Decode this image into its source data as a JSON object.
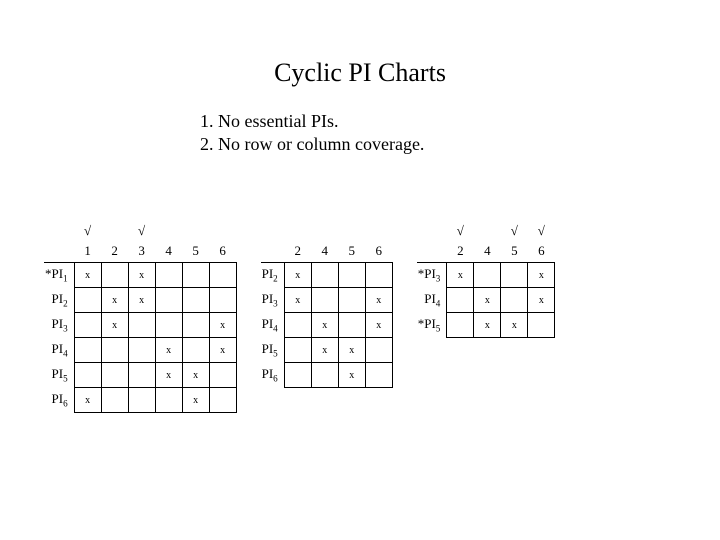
{
  "title": "Cyclic PI Charts",
  "item1": "1.  No essential PIs.",
  "item2": "2.  No row or column coverage.",
  "tick": "√",
  "mark": "x",
  "t1_c1": "1",
  "t1_c2": "2",
  "t1_c3": "3",
  "t1_c4": "4",
  "t1_c5": "5",
  "t1_c6": "6",
  "t1_r1": "*PI",
  "t1_r1s": "1",
  "t1_r2": "PI",
  "t1_r2s": "2",
  "t1_r3": "PI",
  "t1_r3s": "3",
  "t1_r4": "PI",
  "t1_r4s": "4",
  "t1_r5": "PI",
  "t1_r5s": "5",
  "t1_r6": "PI",
  "t1_r6s": "6",
  "t2_c1": "2",
  "t2_c2": "4",
  "t2_c3": "5",
  "t2_c4": "6",
  "t2_r1": "PI",
  "t2_r1s": "2",
  "t2_r2": "PI",
  "t2_r2s": "3",
  "t2_r3": "PI",
  "t2_r3s": "4",
  "t2_r4": "PI",
  "t2_r4s": "5",
  "t2_r5": "PI",
  "t2_r5s": "6",
  "t3_c1": "2",
  "t3_c2": "4",
  "t3_c3": "5",
  "t3_c4": "6",
  "t3_r1": "*PI",
  "t3_r1s": "3",
  "t3_r2": "PI",
  "t3_r2s": "4",
  "t3_r3": "*PI",
  "t3_r3s": "5"
}
